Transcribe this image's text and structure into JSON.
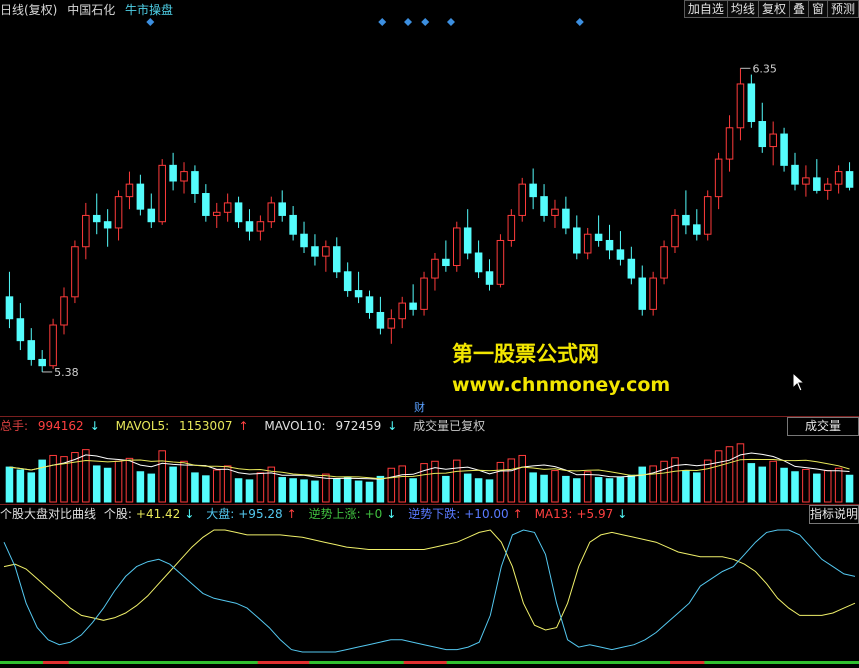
{
  "topbar": {
    "period": "日线(复权)",
    "stock": "中国石化",
    "formula": "牛市操盘",
    "buttons": [
      "加自选",
      "均线",
      "复权",
      "叠",
      "窗",
      "预测"
    ]
  },
  "volume_header": {
    "total_label": "总手:",
    "total_value": "994162",
    "mavol5_label": "MAVOL5:",
    "mavol5_value": "1153007",
    "mavol10_label": "MAVOL10:",
    "mavol10_value": "972459",
    "note": "成交量已复权",
    "button": "成交量"
  },
  "indicator_header": {
    "name": "个股大盘对比曲线",
    "stock_label": "个股:",
    "stock_value": "+41.42",
    "market_label": "大盘:",
    "market_value": "+95.28",
    "up_label": "逆势上涨:",
    "up_value": "+0",
    "down_label": "逆势下跌:",
    "down_value": "+10.00",
    "ma_label": "MA13:",
    "ma_value": "+5.97",
    "button": "指标说明"
  },
  "watermark": {
    "line1": "第一股票公式网",
    "line2": "www.chnmoney.com"
  },
  "marker_text": "财",
  "colors": {
    "up": "#ff3b3b",
    "down": "#54fcfc",
    "stock_line": "#54c8f0",
    "market_line": "#f0f06a",
    "ma_line": "#ffffff",
    "accent_yellow": "#f2e600"
  },
  "chart_data": [
    {
      "type": "candlestick",
      "name": "price",
      "high_label": "6.35",
      "low_label": "5.38",
      "ylim": [
        5.3,
        6.45
      ],
      "ohlc": [
        [
          5.62,
          5.7,
          5.52,
          5.55
        ],
        [
          5.55,
          5.6,
          5.45,
          5.48
        ],
        [
          5.48,
          5.52,
          5.4,
          5.42
        ],
        [
          5.42,
          5.45,
          5.38,
          5.4
        ],
        [
          5.4,
          5.55,
          5.39,
          5.53
        ],
        [
          5.53,
          5.65,
          5.5,
          5.62
        ],
        [
          5.62,
          5.8,
          5.6,
          5.78
        ],
        [
          5.78,
          5.92,
          5.74,
          5.88
        ],
        [
          5.88,
          5.95,
          5.82,
          5.86
        ],
        [
          5.86,
          5.9,
          5.78,
          5.84
        ],
        [
          5.84,
          5.96,
          5.8,
          5.94
        ],
        [
          5.94,
          6.02,
          5.9,
          5.98
        ],
        [
          5.98,
          6.01,
          5.88,
          5.9
        ],
        [
          5.9,
          5.95,
          5.84,
          5.86
        ],
        [
          5.86,
          6.06,
          5.85,
          6.04
        ],
        [
          6.04,
          6.08,
          5.96,
          5.99
        ],
        [
          5.99,
          6.05,
          5.95,
          6.02
        ],
        [
          6.02,
          6.04,
          5.92,
          5.95
        ],
        [
          5.95,
          5.98,
          5.86,
          5.88
        ],
        [
          5.88,
          5.92,
          5.84,
          5.89
        ],
        [
          5.89,
          5.95,
          5.86,
          5.92
        ],
        [
          5.92,
          5.94,
          5.84,
          5.86
        ],
        [
          5.86,
          5.9,
          5.8,
          5.83
        ],
        [
          5.83,
          5.88,
          5.8,
          5.86
        ],
        [
          5.86,
          5.94,
          5.84,
          5.92
        ],
        [
          5.92,
          5.96,
          5.86,
          5.88
        ],
        [
          5.88,
          5.91,
          5.8,
          5.82
        ],
        [
          5.82,
          5.86,
          5.76,
          5.78
        ],
        [
          5.78,
          5.82,
          5.72,
          5.75
        ],
        [
          5.75,
          5.8,
          5.7,
          5.78
        ],
        [
          5.78,
          5.81,
          5.68,
          5.7
        ],
        [
          5.7,
          5.73,
          5.62,
          5.64
        ],
        [
          5.64,
          5.7,
          5.6,
          5.62
        ],
        [
          5.62,
          5.64,
          5.55,
          5.57
        ],
        [
          5.57,
          5.62,
          5.5,
          5.52
        ],
        [
          5.52,
          5.58,
          5.47,
          5.55
        ],
        [
          5.55,
          5.62,
          5.52,
          5.6
        ],
        [
          5.6,
          5.66,
          5.56,
          5.58
        ],
        [
          5.58,
          5.7,
          5.56,
          5.68
        ],
        [
          5.68,
          5.76,
          5.64,
          5.74
        ],
        [
          5.74,
          5.8,
          5.7,
          5.72
        ],
        [
          5.72,
          5.86,
          5.7,
          5.84
        ],
        [
          5.84,
          5.9,
          5.74,
          5.76
        ],
        [
          5.76,
          5.8,
          5.68,
          5.7
        ],
        [
          5.7,
          5.74,
          5.64,
          5.66
        ],
        [
          5.66,
          5.82,
          5.65,
          5.8
        ],
        [
          5.8,
          5.9,
          5.78,
          5.88
        ],
        [
          5.88,
          6.0,
          5.86,
          5.98
        ],
        [
          5.98,
          6.03,
          5.9,
          5.94
        ],
        [
          5.94,
          5.98,
          5.86,
          5.88
        ],
        [
          5.88,
          5.93,
          5.84,
          5.9
        ],
        [
          5.9,
          5.94,
          5.82,
          5.84
        ],
        [
          5.84,
          5.88,
          5.74,
          5.76
        ],
        [
          5.76,
          5.84,
          5.74,
          5.82
        ],
        [
          5.82,
          5.88,
          5.78,
          5.8
        ],
        [
          5.8,
          5.85,
          5.74,
          5.77
        ],
        [
          5.77,
          5.83,
          5.72,
          5.74
        ],
        [
          5.74,
          5.78,
          5.66,
          5.68
        ],
        [
          5.68,
          5.72,
          5.56,
          5.58
        ],
        [
          5.58,
          5.7,
          5.56,
          5.68
        ],
        [
          5.68,
          5.8,
          5.66,
          5.78
        ],
        [
          5.78,
          5.9,
          5.76,
          5.88
        ],
        [
          5.88,
          5.96,
          5.82,
          5.85
        ],
        [
          5.85,
          5.9,
          5.8,
          5.82
        ],
        [
          5.82,
          5.96,
          5.8,
          5.94
        ],
        [
          5.94,
          6.08,
          5.9,
          6.06
        ],
        [
          6.06,
          6.2,
          6.02,
          6.16
        ],
        [
          6.16,
          6.35,
          6.12,
          6.3
        ],
        [
          6.3,
          6.33,
          6.16,
          6.18
        ],
        [
          6.18,
          6.24,
          6.08,
          6.1
        ],
        [
          6.1,
          6.18,
          6.04,
          6.14
        ],
        [
          6.14,
          6.16,
          6.02,
          6.04
        ],
        [
          6.04,
          6.08,
          5.96,
          5.98
        ],
        [
          5.98,
          6.04,
          5.94,
          6.0
        ],
        [
          6.0,
          6.06,
          5.95,
          5.96
        ],
        [
          5.96,
          6.0,
          5.93,
          5.98
        ],
        [
          5.98,
          6.04,
          5.95,
          6.02
        ],
        [
          6.02,
          6.05,
          5.96,
          5.97
        ]
      ]
    },
    {
      "type": "bar",
      "name": "volume",
      "up_flags": [
        0,
        0,
        0,
        0,
        1,
        1,
        1,
        1,
        0,
        0,
        1,
        1,
        0,
        0,
        1,
        0,
        1,
        0,
        0,
        1,
        1,
        0,
        0,
        1,
        1,
        0,
        0,
        0,
        0,
        1,
        0,
        0,
        0,
        0,
        0,
        1,
        1,
        0,
        1,
        1,
        0,
        1,
        0,
        0,
        0,
        1,
        1,
        1,
        0,
        0,
        1,
        0,
        0,
        1,
        0,
        0,
        0,
        0,
        0,
        1,
        1,
        1,
        0,
        0,
        1,
        1,
        1,
        1,
        0,
        0,
        1,
        0,
        0,
        1,
        0,
        1,
        1,
        0
      ],
      "values": [
        60,
        55,
        50,
        72,
        80,
        78,
        85,
        90,
        62,
        58,
        70,
        75,
        52,
        48,
        88,
        60,
        70,
        50,
        45,
        55,
        62,
        40,
        38,
        50,
        60,
        42,
        40,
        38,
        36,
        48,
        40,
        42,
        36,
        34,
        44,
        58,
        62,
        40,
        66,
        70,
        44,
        72,
        48,
        40,
        38,
        68,
        74,
        80,
        50,
        46,
        54,
        44,
        40,
        52,
        42,
        40,
        42,
        46,
        60,
        62,
        70,
        76,
        54,
        50,
        72,
        88,
        95,
        100,
        66,
        60,
        70,
        58,
        52,
        56,
        48,
        54,
        58,
        46
      ],
      "mavol5_label": "MAVOL5",
      "mavol10_label": "MAVOL10",
      "ylim": [
        0,
        110
      ]
    },
    {
      "type": "line",
      "name": "个股大盘对比曲线",
      "x": [
        0,
        1,
        2,
        3,
        4,
        5,
        6,
        7,
        8,
        9,
        10,
        11,
        12,
        13,
        14,
        15,
        16,
        17,
        18,
        19,
        20,
        21,
        22,
        23,
        24,
        25,
        26,
        27,
        28,
        29,
        30,
        31,
        32,
        33,
        34,
        35,
        36,
        37,
        38,
        39,
        40,
        41,
        42,
        43,
        44,
        45,
        46,
        47,
        48,
        49,
        50,
        51,
        52,
        53,
        54,
        55,
        56,
        57,
        58,
        59,
        60,
        61,
        62,
        63,
        64,
        65,
        66,
        67,
        68,
        69,
        70,
        71,
        72,
        73,
        74,
        75,
        76,
        77
      ],
      "series": [
        {
          "name": "个股",
          "values": [
            70,
            72,
            68,
            60,
            52,
            44,
            36,
            30,
            28,
            26,
            28,
            32,
            38,
            46,
            56,
            66,
            76,
            86,
            94,
            100,
            100,
            98,
            96,
            96,
            96,
            96,
            95,
            94,
            92,
            90,
            88,
            86,
            85,
            84,
            84,
            84,
            84,
            84,
            84,
            86,
            88,
            90,
            94,
            98,
            100,
            90,
            70,
            40,
            22,
            18,
            20,
            40,
            70,
            90,
            96,
            98,
            96,
            94,
            92,
            90,
            86,
            82,
            80,
            78,
            78,
            78,
            76,
            72,
            66,
            56,
            44,
            36,
            30,
            30,
            30,
            32,
            36,
            40
          ]
        },
        {
          "name": "大盘",
          "values": [
            90,
            70,
            40,
            20,
            10,
            6,
            8,
            14,
            24,
            36,
            50,
            62,
            70,
            74,
            76,
            72,
            64,
            56,
            48,
            44,
            42,
            40,
            36,
            28,
            20,
            10,
            2,
            0,
            0,
            0,
            0,
            2,
            4,
            6,
            8,
            10,
            10,
            8,
            6,
            4,
            2,
            2,
            4,
            8,
            30,
            70,
            96,
            100,
            98,
            80,
            40,
            10,
            4,
            6,
            4,
            2,
            4,
            6,
            10,
            16,
            24,
            32,
            40,
            54,
            60,
            66,
            70,
            80,
            90,
            98,
            100,
            100,
            96,
            86,
            76,
            70,
            64,
            62
          ]
        }
      ],
      "ylim": [
        0,
        100
      ]
    }
  ]
}
